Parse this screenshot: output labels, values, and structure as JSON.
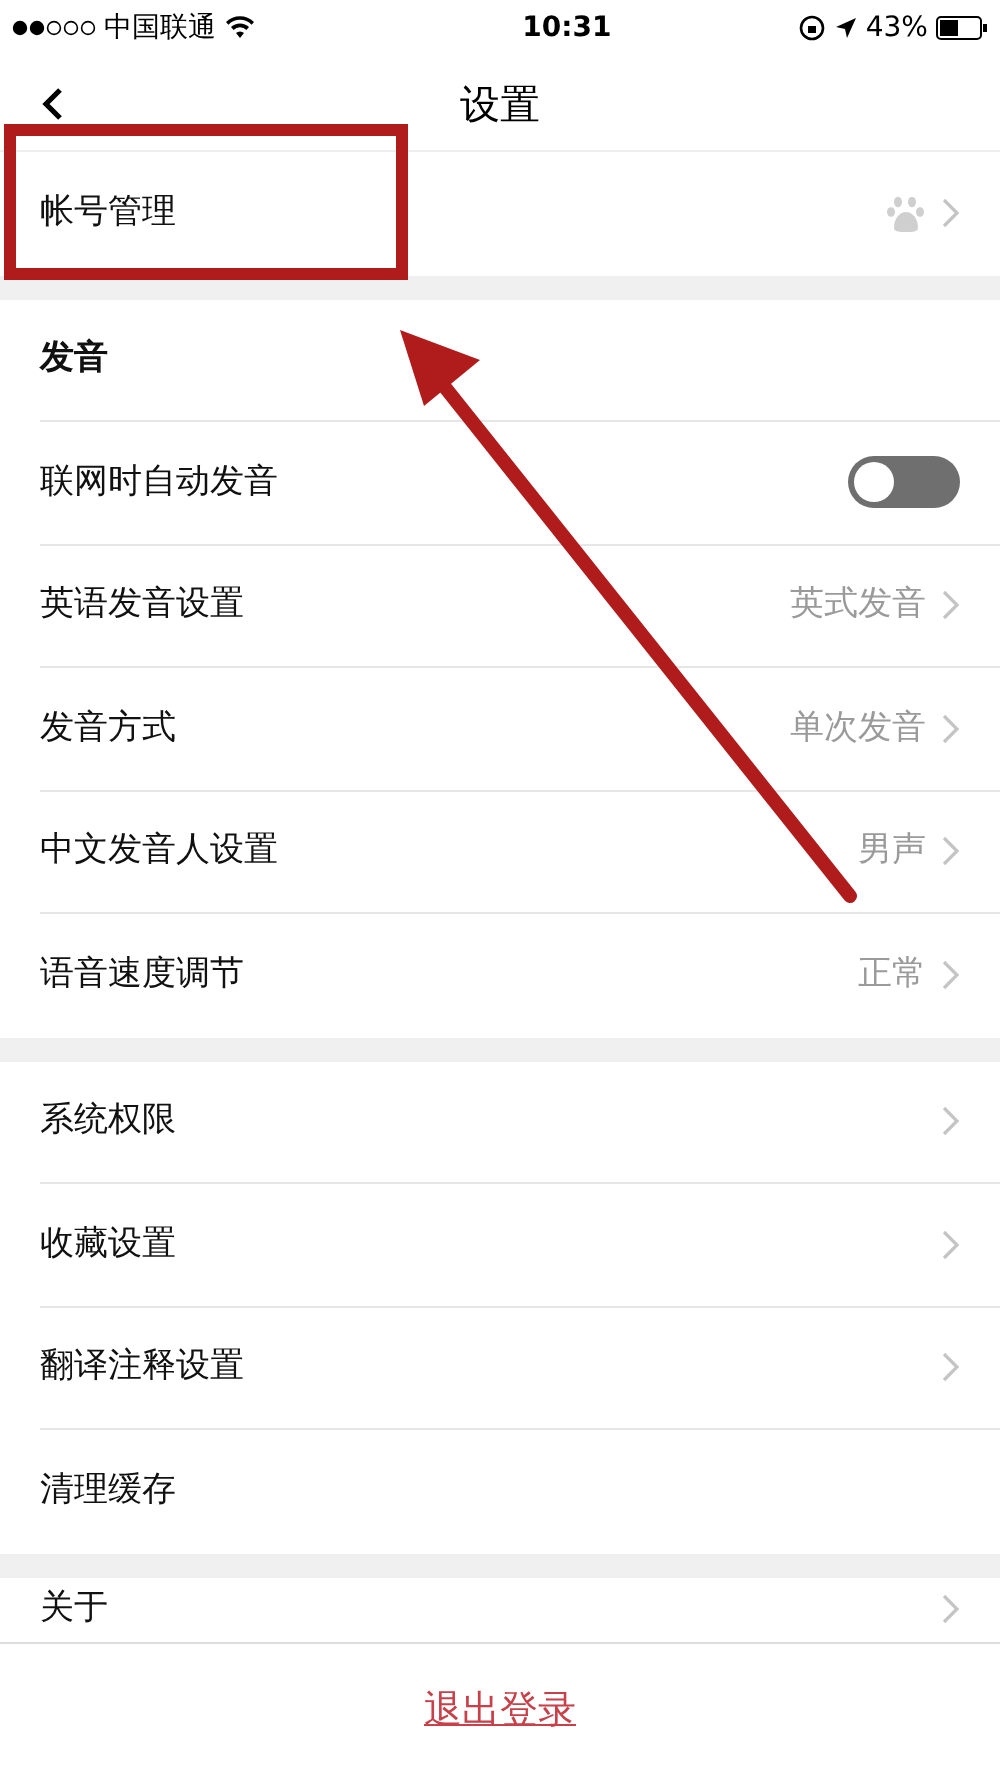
{
  "status_bar": {
    "carrier": "中国联通",
    "time": "10:31",
    "battery": "43%"
  },
  "nav": {
    "title": "设置"
  },
  "groups": [
    {
      "items": [
        {
          "kind": "account",
          "label": "帐号管理"
        }
      ]
    },
    {
      "items": [
        {
          "kind": "header",
          "label": "发音"
        },
        {
          "kind": "toggle",
          "label": "联网时自动发音",
          "on": false
        },
        {
          "kind": "value",
          "label": "英语发音设置",
          "value": "英式发音"
        },
        {
          "kind": "value",
          "label": "发音方式",
          "value": "单次发音"
        },
        {
          "kind": "value",
          "label": "中文发音人设置",
          "value": "男声"
        },
        {
          "kind": "value",
          "label": "语音速度调节",
          "value": "正常"
        }
      ]
    },
    {
      "items": [
        {
          "kind": "link",
          "label": "系统权限"
        },
        {
          "kind": "link",
          "label": "收藏设置"
        },
        {
          "kind": "link",
          "label": "翻译注释设置"
        },
        {
          "kind": "plain",
          "label": "清理缓存"
        }
      ]
    },
    {
      "items": [
        {
          "kind": "cut",
          "label": "关于"
        }
      ]
    }
  ],
  "logout": "退出登录"
}
